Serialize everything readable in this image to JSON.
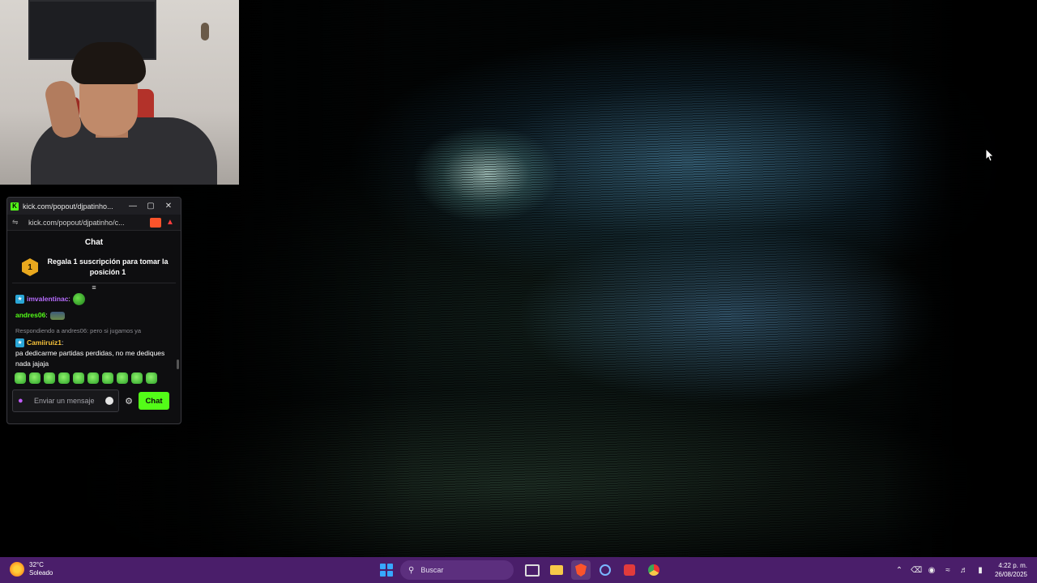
{
  "chat_window": {
    "title": "kick.com/popout/djpatinho...",
    "url": "kick.com/popout/djpatinho/c...",
    "header": "Chat",
    "promo": {
      "rank": "1",
      "text": "Regala 1 suscripción para tomar la posición 1"
    },
    "messages": [
      {
        "user": "imvalentinac",
        "text": ""
      },
      {
        "user": "andres06",
        "text": ""
      },
      {
        "reply_to": "Respondiendo a andres06: pero si jugamos ya",
        "user": "Camiiruiz1",
        "text": "pa dedicarme partidas perdidas, no me dediques nada jajaja"
      }
    ],
    "input_placeholder": "Enviar un mensaje",
    "send_label": "Chat"
  },
  "taskbar": {
    "weather_temp": "32°C",
    "weather_desc": "Soleado",
    "search_label": "Buscar",
    "time": "4:22 p. m.",
    "date": "26/08/2025"
  },
  "colors": {
    "kick_green": "#53fc18",
    "taskbar_bg": "#4a1e6a",
    "chat_bg": "#0e0e10"
  }
}
